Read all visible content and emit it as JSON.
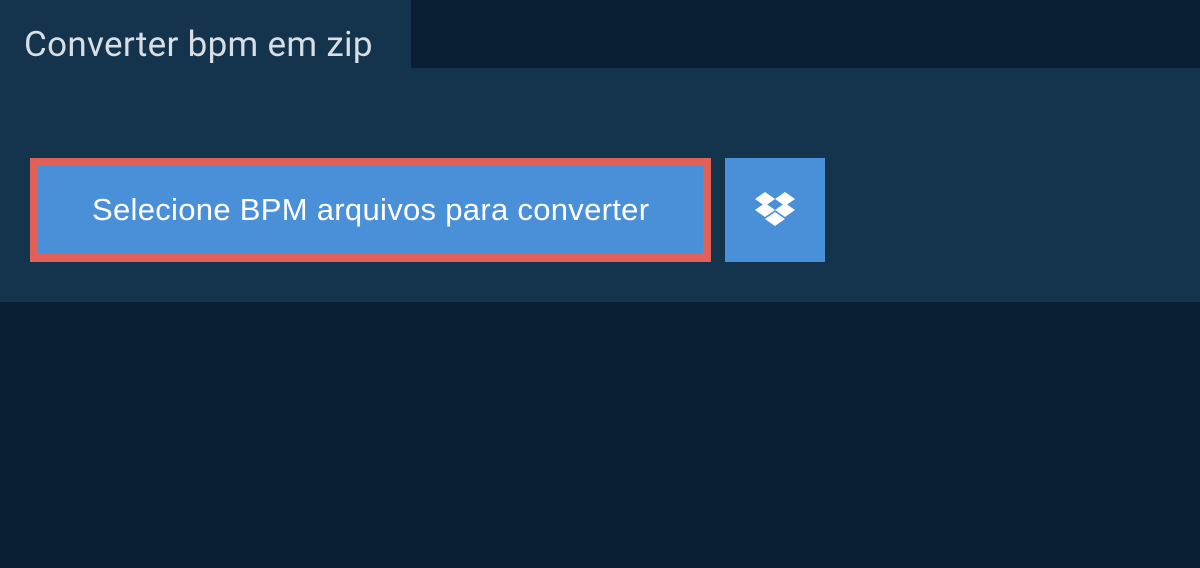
{
  "header": {
    "tab_title": "Converter bpm em zip"
  },
  "main": {
    "select_button_label": "Selecione BPM arquivos para converter"
  },
  "colors": {
    "background": "#0a1f33",
    "panel": "#14334d",
    "button": "#4a90d9",
    "highlight_border": "#e16057",
    "text_light": "#d7dee4",
    "text_white": "#ffffff"
  }
}
